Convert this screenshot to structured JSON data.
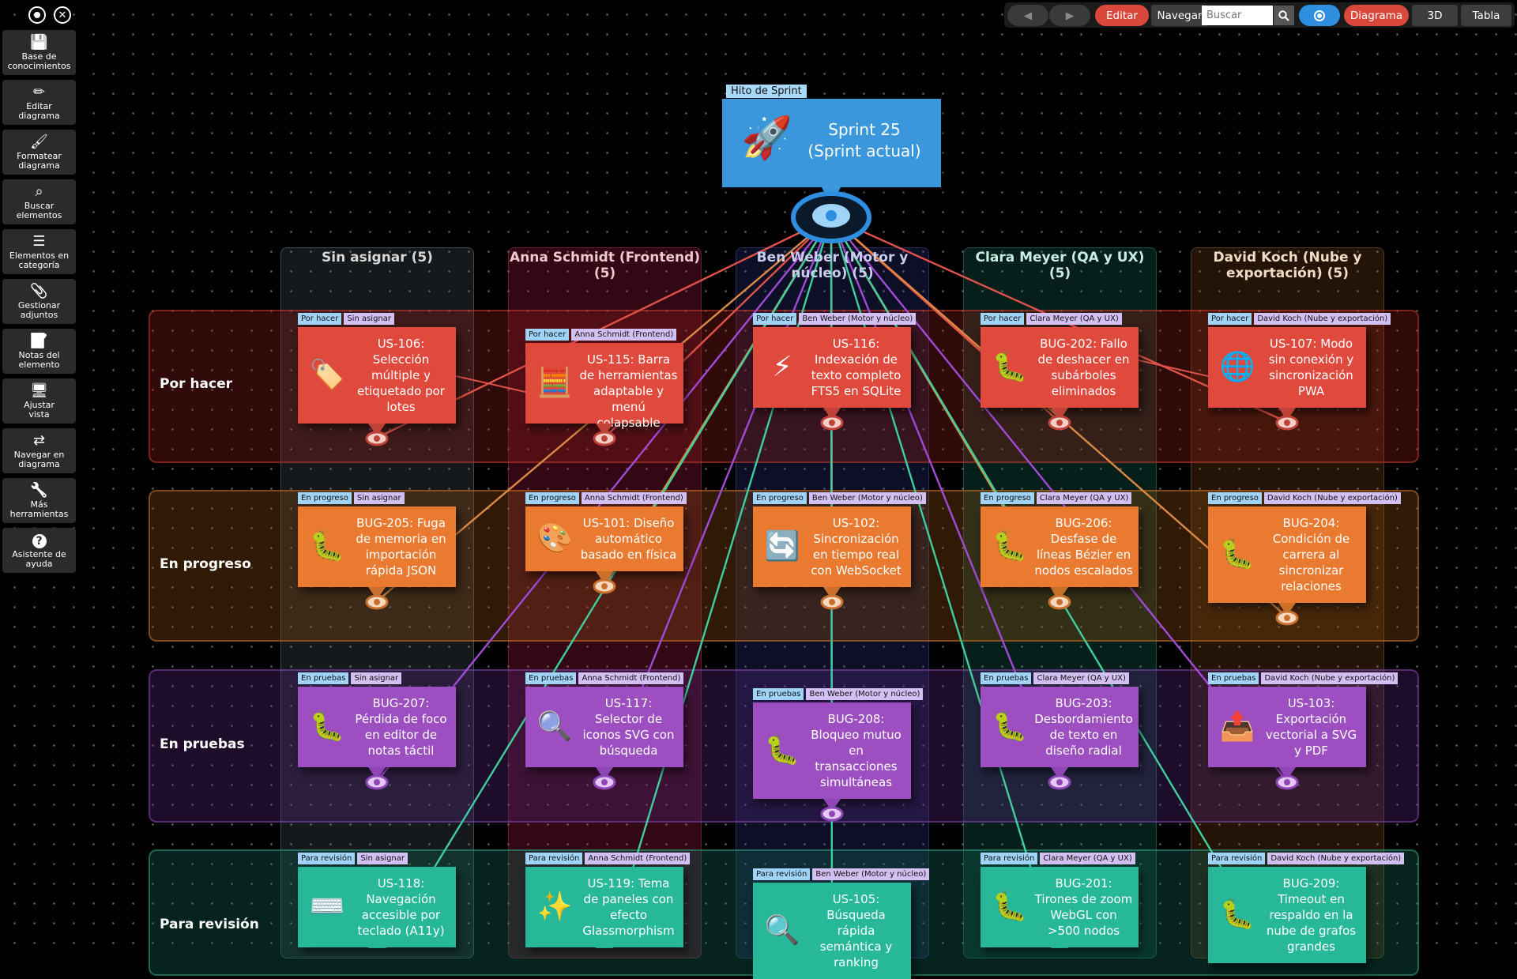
{
  "toolbar_top": {
    "target_icon": "target-icon",
    "close_icon": "close-icon"
  },
  "sidebar": {
    "items": [
      {
        "label": "Base de\nconocimientos",
        "icon": "save-icon"
      },
      {
        "label": "Editar\ndiagrama",
        "icon": "pencil-icon"
      },
      {
        "label": "Formatear\ndiagrama",
        "icon": "brush-icon"
      },
      {
        "label": "Buscar\nelementos",
        "icon": "search-icon"
      },
      {
        "label": "Elementos en\ncategoría",
        "icon": "list-icon"
      },
      {
        "label": "Gestionar\nadjuntos",
        "icon": "attachment-icon"
      },
      {
        "label": "Notas del\nelemento",
        "icon": "notes-icon"
      },
      {
        "label": "Ajustar\nvista",
        "icon": "monitor-icon"
      },
      {
        "label": "Navegar en\ndiagrama",
        "icon": "swap-icon"
      },
      {
        "label": "Más\nherramientas",
        "icon": "wrench-icon"
      },
      {
        "label": "Asistente de\nayuda",
        "icon": "help-icon"
      }
    ]
  },
  "topbar": {
    "back_icon": "arrow-left-icon",
    "forward_icon": "arrow-right-icon",
    "edit": "Editar",
    "navigate": "Navegar",
    "search_placeholder": "Buscar",
    "search_icon": "search-icon",
    "focus_icon": "target-icon",
    "diagram": "Diagrama",
    "view3d": "3D",
    "table": "Tabla"
  },
  "milestone": {
    "tag": "Hito de Sprint",
    "title": "Sprint 25\n(Sprint actual)",
    "icon": "rocket-icon"
  },
  "columns": [
    "Sin asignar (5)",
    "Anna Schmidt (Frontend) (5)",
    "Ben Weber (Motor y núcleo) (5)",
    "Clara Meyer (QA y UX) (5)",
    "David Koch (Nube y exportación) (5)"
  ],
  "rows": [
    "Por hacer",
    "En progreso",
    "En pruebas",
    "Para revisión"
  ],
  "cards": [
    {
      "id": "US-106",
      "status": "Por hacer",
      "assignee": "Sin asignar",
      "text": "US-106: Selección múltiple y etiquetado por lotes",
      "icon": "tag-icon",
      "glyph": "🏷️"
    },
    {
      "id": "US-115",
      "status": "Por hacer",
      "assignee": "Anna Schmidt (Frontend)",
      "text": "US-115: Barra de herramientas adaptable y menú colapsable",
      "icon": "calculator-icon",
      "glyph": "🧮"
    },
    {
      "id": "US-116",
      "status": "Por hacer",
      "assignee": "Ben Weber (Motor y núcleo)",
      "text": "US-116: Indexación de texto completo FTS5 en SQLite",
      "icon": "lightning-icon",
      "glyph": "⚡"
    },
    {
      "id": "BUG-202",
      "status": "Por hacer",
      "assignee": "Clara Meyer (QA y UX)",
      "text": "BUG-202: Fallo de deshacer en subárboles eliminados",
      "icon": "bug-icon",
      "glyph": "🐛"
    },
    {
      "id": "US-107",
      "status": "Por hacer",
      "assignee": "David Koch (Nube y exportación)",
      "text": "US-107: Modo sin conexión y sincronización PWA",
      "icon": "globe-icon",
      "glyph": "🌐"
    },
    {
      "id": "BUG-205",
      "status": "En progreso",
      "assignee": "Sin asignar",
      "text": "BUG-205: Fuga de memoria en importación rápida JSON",
      "icon": "bug-icon",
      "glyph": "🐛"
    },
    {
      "id": "US-101",
      "status": "En progreso",
      "assignee": "Anna Schmidt (Frontend)",
      "text": "US-101: Diseño automático basado en física",
      "icon": "palette-icon",
      "glyph": "🎨"
    },
    {
      "id": "US-102",
      "status": "En progreso",
      "assignee": "Ben Weber (Motor y núcleo)",
      "text": "US-102: Sincronización en tiempo real con WebSocket",
      "icon": "sync-icon",
      "glyph": "🔄"
    },
    {
      "id": "BUG-206",
      "status": "En progreso",
      "assignee": "Clara Meyer (QA y UX)",
      "text": "BUG-206: Desfase de líneas Bézier en nodos escalados",
      "icon": "bug-icon",
      "glyph": "🐛"
    },
    {
      "id": "BUG-204",
      "status": "En progreso",
      "assignee": "David Koch (Nube y exportación)",
      "text": "BUG-204: Condición de carrera al sincronizar relaciones",
      "icon": "bug-icon",
      "glyph": "🐛"
    },
    {
      "id": "BUG-207",
      "status": "En pruebas",
      "assignee": "Sin asignar",
      "text": "BUG-207: Pérdida de foco en editor de notas táctil",
      "icon": "bug-icon",
      "glyph": "🐛"
    },
    {
      "id": "US-117",
      "status": "En pruebas",
      "assignee": "Anna Schmidt (Frontend)",
      "text": "US-117: Selector de iconos SVG con búsqueda",
      "icon": "magnifier-icon",
      "glyph": "🔍"
    },
    {
      "id": "BUG-208",
      "status": "En pruebas",
      "assignee": "Ben Weber (Motor y núcleo)",
      "text": "BUG-208: Bloqueo mutuo en transacciones simultáneas",
      "icon": "bug-icon",
      "glyph": "🐛"
    },
    {
      "id": "BUG-203",
      "status": "En pruebas",
      "assignee": "Clara Meyer (QA y UX)",
      "text": "BUG-203: Desbordamiento de texto en diseño radial",
      "icon": "bug-icon",
      "glyph": "🐛"
    },
    {
      "id": "US-103",
      "status": "En pruebas",
      "assignee": "David Koch (Nube y exportación)",
      "text": "US-103: Exportación vectorial a SVG y PDF",
      "icon": "upload-icon",
      "glyph": "📤"
    },
    {
      "id": "US-118",
      "status": "Para revisión",
      "assignee": "Sin asignar",
      "text": "US-118: Navegación accesible por teclado (A11y)",
      "icon": "keyboard-icon",
      "glyph": "⌨️"
    },
    {
      "id": "US-119",
      "status": "Para revisión",
      "assignee": "Anna Schmidt (Frontend)",
      "text": "US-119: Tema de paneles con efecto Glassmorphism",
      "icon": "sparkles-icon",
      "glyph": "✨"
    },
    {
      "id": "US-105",
      "status": "Para revisión",
      "assignee": "Ben Weber (Motor y núcleo)",
      "text": "US-105: Búsqueda rápida semántica y ranking",
      "icon": "magnifier-icon",
      "glyph": "🔍"
    },
    {
      "id": "BUG-201",
      "status": "Para revisión",
      "assignee": "Clara Meyer (QA y UX)",
      "text": "BUG-201: Tirones de zoom WebGL con >500 nodos",
      "icon": "bug-icon",
      "glyph": "🐛"
    },
    {
      "id": "BUG-209",
      "status": "Para revisión",
      "assignee": "David Koch (Nube y exportación)",
      "text": "BUG-209: Timeout en respaldo en la nube de grafos grandes",
      "icon": "bug-icon",
      "glyph": "🐛"
    }
  ],
  "colors": {
    "todo": "#e04a3c",
    "progress": "#e97a30",
    "testing": "#9d4fc2",
    "review": "#27b89a",
    "milestone": "#3a97dc",
    "accent_red": "#d9483b",
    "accent_blue": "#2e8fe0"
  }
}
